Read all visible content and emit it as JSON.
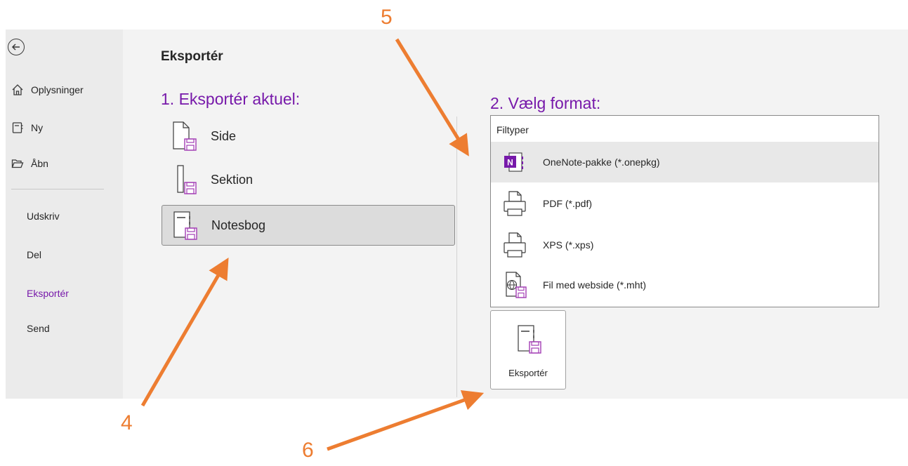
{
  "sidebar": {
    "items": [
      {
        "label": "Oplysninger",
        "icon": "home-icon"
      },
      {
        "label": "Ny",
        "icon": "new-notebook-icon"
      },
      {
        "label": "Åbn",
        "icon": "open-folder-icon"
      },
      {
        "label": "Udskriv"
      },
      {
        "label": "Del"
      },
      {
        "label": "Eksportér",
        "active": true
      },
      {
        "label": "Send"
      }
    ]
  },
  "main": {
    "title": "Eksportér",
    "section1_heading": "1. Eksportér aktuel:",
    "section2_heading": "2. Vælg format:",
    "scope_options": [
      {
        "label": "Side"
      },
      {
        "label": "Sektion"
      },
      {
        "label": "Notesbog",
        "selected": true
      }
    ],
    "filetypes": {
      "header": "Filtyper",
      "items": [
        {
          "label": "OneNote-pakke (*.onepkg)",
          "selected": true
        },
        {
          "label": "PDF (*.pdf)"
        },
        {
          "label": "XPS (*.xps)"
        },
        {
          "label": "Fil med webside (*.mht)"
        }
      ]
    },
    "export_button": "Eksportér"
  },
  "annotations": [
    "4",
    "5",
    "6"
  ],
  "colors": {
    "accent": "#7719aa",
    "annotation": "#ed7d31",
    "onenote": "#7719aa"
  }
}
